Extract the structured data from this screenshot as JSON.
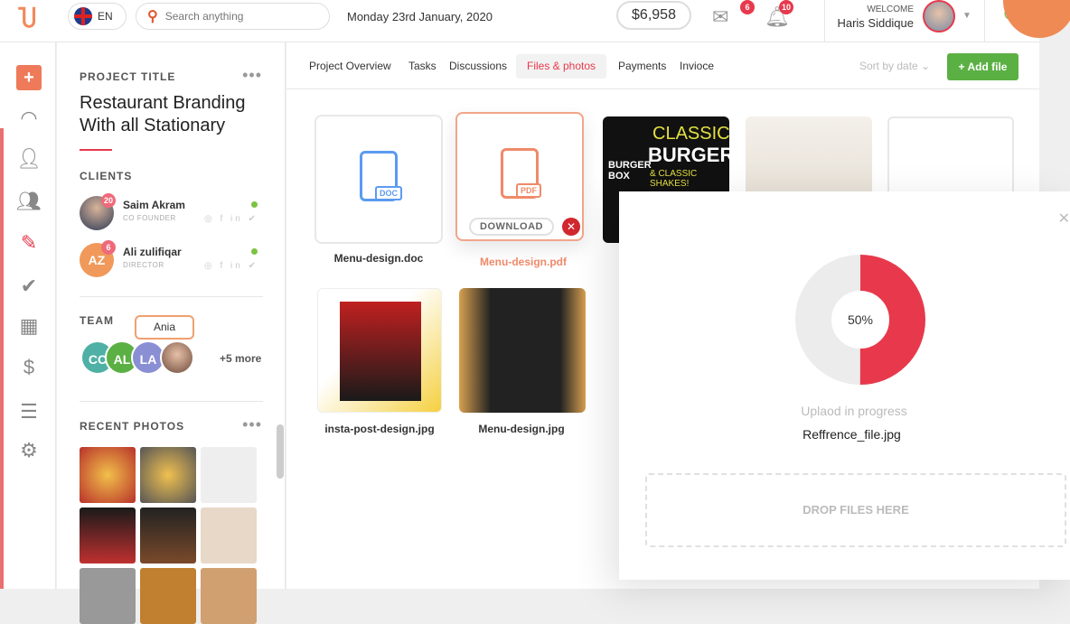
{
  "topbar": {
    "language": "EN",
    "search_placeholder": "Search anything",
    "date": "Monday 23rd January, 2020",
    "balance": "$6,958",
    "mail_count": "6",
    "notif_count": "10",
    "welcome": "WELCOME",
    "user_name": "Haris Siddique"
  },
  "project": {
    "label": "PROJECT TITLE",
    "title": "Restaurant Branding With all Stationary",
    "clients_label": "CLIENTS",
    "clients": [
      {
        "name": "Saim Akram",
        "role": "CO FOUNDER",
        "badge": "20",
        "initials": ""
      },
      {
        "name": "Ali zulifiqar",
        "role": "DIRECTOR",
        "badge": "6",
        "initials": "AZ"
      }
    ],
    "team_label": "TEAM",
    "team": [
      "CC",
      "AL",
      "LA"
    ],
    "tooltip": "Ania",
    "more": "+5 more",
    "recent_label": "RECENT PHOTOS",
    "social": "◎ f in ✔"
  },
  "tabs": [
    "Project Overview",
    "Tasks",
    "Discussions",
    "Files & photos",
    "Payments",
    "Invioce"
  ],
  "active_tab": "Files & photos",
  "sort_label": "Sort by date",
  "add_file": "Add file",
  "files": [
    {
      "name": "Menu-design.doc",
      "type": "DOC"
    },
    {
      "name": "Menu-design.pdf",
      "type": "PDF",
      "download": "DOWNLOAD"
    },
    {
      "name": "insta-post-design.jpg"
    },
    {
      "name": "Menu-design.jpg"
    }
  ],
  "burger_poster": {
    "l1": "CLASSIC",
    "l2": "BURGERS",
    "l3": "BURGER BOX",
    "l4": "& CLASSIC SHAKES!"
  },
  "upload": {
    "progress": 50,
    "progress_label": "50%",
    "status": "Uplaod in progress",
    "filename": "Reffrence_file.jpg",
    "drop": "DROP FILES HERE"
  },
  "colors": {
    "accent": "#e8394c",
    "primary_green": "#5bb043",
    "doc_blue": "#5b9bf0",
    "pdf_orange": "#ef8a6a"
  }
}
